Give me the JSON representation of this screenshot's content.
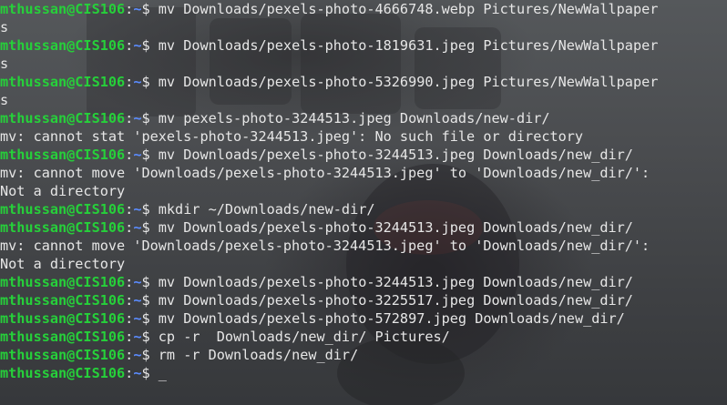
{
  "terminal": {
    "prompt": {
      "user_host": "mthussan@CIS106",
      "colon": ":",
      "path": "~",
      "symbol": "$ "
    },
    "lines": [
      {
        "type": "cmd",
        "text": "mv Downloads/pexels-photo-4666748.webp Pictures/NewWallpaper"
      },
      {
        "type": "out",
        "text": "s"
      },
      {
        "type": "cmd",
        "text": "mv Downloads/pexels-photo-1819631.jpeg Pictures/NewWallpaper"
      },
      {
        "type": "out",
        "text": "s"
      },
      {
        "type": "cmd",
        "text": "mv Downloads/pexels-photo-5326990.jpeg Pictures/NewWallpaper"
      },
      {
        "type": "out",
        "text": "s"
      },
      {
        "type": "cmd",
        "text": "mv pexels-photo-3244513.jpeg Downloads/new-dir/"
      },
      {
        "type": "out",
        "text": "mv: cannot stat 'pexels-photo-3244513.jpeg': No such file or directory"
      },
      {
        "type": "cmd",
        "text": "mv Downloads/pexels-photo-3244513.jpeg Downloads/new_dir/"
      },
      {
        "type": "out",
        "text": "mv: cannot move 'Downloads/pexels-photo-3244513.jpeg' to 'Downloads/new_dir/':"
      },
      {
        "type": "out",
        "text": "Not a directory"
      },
      {
        "type": "cmd",
        "text": "mkdir ~/Downloads/new-dir/"
      },
      {
        "type": "cmd",
        "text": "mv Downloads/pexels-photo-3244513.jpeg Downloads/new_dir/"
      },
      {
        "type": "out",
        "text": "mv: cannot move 'Downloads/pexels-photo-3244513.jpeg' to 'Downloads/new_dir/':"
      },
      {
        "type": "out",
        "text": "Not a directory"
      },
      {
        "type": "cmd",
        "text": "mv Downloads/pexels-photo-3244513.jpeg Downloads/new_dir/"
      },
      {
        "type": "cmd",
        "text": "mv Downloads/pexels-photo-3225517.jpeg Downloads/new_dir/"
      },
      {
        "type": "cmd",
        "text": "mv Downloads/pexels-photo-572897.jpeg Downloads/new_dir/"
      },
      {
        "type": "cmd",
        "text": "cp -r  Downloads/new_dir/ Pictures/"
      },
      {
        "type": "cmd",
        "text": "rm -r Downloads/new_dir/"
      },
      {
        "type": "cmd",
        "text": "_"
      }
    ]
  }
}
